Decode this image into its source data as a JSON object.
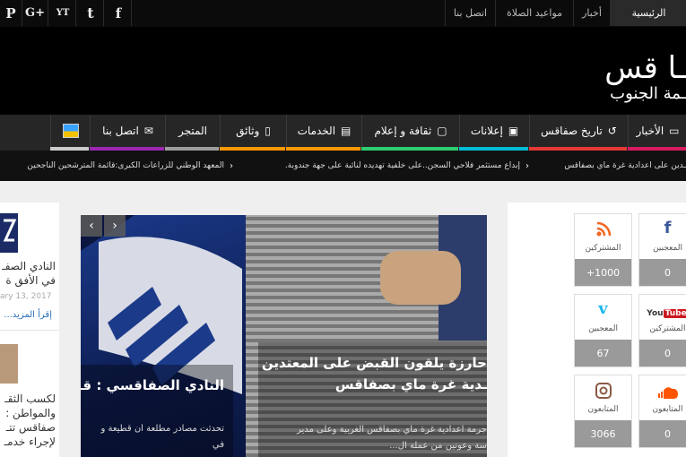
{
  "topbar": {
    "social": [
      "P",
      "G+",
      "YT",
      "t",
      "f"
    ],
    "nav": [
      "الرئيسية",
      "أخبار",
      "مواعيد الصلاة",
      "اتصل بنا"
    ]
  },
  "logo": {
    "title": "ـا قس",
    "subtitle": "ـمة الجنوب"
  },
  "mainnav": {
    "items": [
      {
        "label": "الأخبار",
        "color": "#d81b60"
      },
      {
        "label": "تاريخ صفاقس",
        "color": "#e53935"
      },
      {
        "label": "إعلانات",
        "color": "#00bcd4"
      },
      {
        "label": "ثقافة و إعلام",
        "color": "#2ecc71"
      },
      {
        "label": "الخدمات",
        "color": "#ff9800"
      },
      {
        "label": "وثائق",
        "color": "#ff9800"
      },
      {
        "label": "المتجر",
        "color": "#9e9e9e"
      },
      {
        "label": "اتصل بنا",
        "color": "#9c27b0"
      }
    ]
  },
  "ticker": {
    "items": [
      "ـدين على اعدادية غرة ماي بصفاقس",
      "إبداع مستثمر فلاحي السجن..على خلفية تهديده لنائبة على جهة جندوبة.",
      "المعهد الوطني للزراعات الكبرى:قائمة المترشحين الناجحين"
    ]
  },
  "left_posts": [
    {
      "title": "النادي الصفـ",
      "subtitle": "في الأفق ة",
      "date": "ary 13, 2017",
      "more": "إقرأ المزيد..."
    },
    {
      "title": "لكسب الثقـ",
      "lines": [
        "والمواطن :",
        "صفاقس تتـ",
        "لإجراء خدمـ"
      ]
    }
  ],
  "slider": {
    "slides": [
      {
        "title": "النادي الصفاقسي : قـ",
        "excerpt": "تحدثت مصادر مطلعة أن قطيعة و",
        "excerpt2": "في"
      },
      {
        "title": "حارزة يلقون القبض على المعتدين",
        "title2": "ـدية غرة ماي بصفاقس",
        "excerpt": "جرمة اعدادية غرة ماي بصفاقس الغربية وعلى مدير",
        "excerpt2": "سة وعونين من عملة ال..."
      }
    ]
  },
  "social_counters": [
    {
      "network": "facebook",
      "icon": "f",
      "label": "المعجبين",
      "count": "0",
      "color": "#3b5998"
    },
    {
      "network": "rss",
      "icon": "rss",
      "label": "المشتركين",
      "count": "+1000",
      "color": "#f26522"
    },
    {
      "network": "youtube",
      "icon": "You Tube",
      "label": "المشتركين",
      "count": "0",
      "color": "#cc181e"
    },
    {
      "network": "vimeo",
      "icon": "v",
      "label": "المعجبين",
      "count": "67",
      "color": "#1ab7ea"
    },
    {
      "network": "soundcloud",
      "icon": "sc",
      "label": "المتابعون",
      "count": "0",
      "color": "#ff5500"
    },
    {
      "network": "instagram",
      "icon": "ig",
      "label": "المتابعون",
      "count": "3066",
      "color": "#8a5a44"
    }
  ]
}
